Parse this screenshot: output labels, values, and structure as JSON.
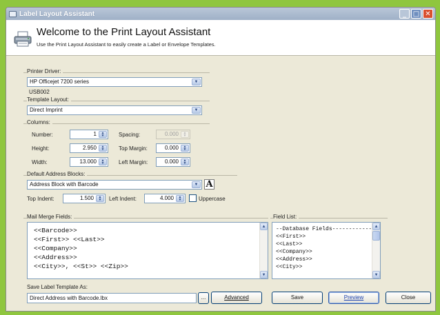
{
  "window": {
    "title": "Label Layout Assistant",
    "controls": {
      "minimize": "_",
      "maximize": "□",
      "close": "✕"
    }
  },
  "header": {
    "heading": "Welcome to the Print Layout Assistant",
    "subheading": "Use the Print Layout Assistant to easily  create a Label or Envelope Templates.",
    "icon": "printer-icon"
  },
  "printer": {
    "group_label": "Printer Driver:",
    "selected": "HP Officejet 7200 series",
    "port": "USB002"
  },
  "template_layout": {
    "group_label": "Template Layout:",
    "selected": "Direct Imprint"
  },
  "columns": {
    "group_label": "Columns:",
    "number_label": "Number:",
    "number_value": "1",
    "spacing_label": "Spacing:",
    "spacing_value": "0.000",
    "height_label": "Height:",
    "height_value": "2.950",
    "top_margin_label": "Top Margin:",
    "top_margin_value": "0.000",
    "width_label": "Width:",
    "width_value": "13.000",
    "left_margin_label": "Left Margin:",
    "left_margin_value": "0.000"
  },
  "address_blocks": {
    "group_label": "Default Address Blocks:",
    "selected": "Address Block with Barcode",
    "font_button": "A",
    "top_indent_label": "Top Indent:",
    "top_indent_value": "1.500",
    "left_indent_label": "Left Indent:",
    "left_indent_value": "4.000",
    "uppercase_label": "Uppercase",
    "uppercase_checked": false
  },
  "mail_merge": {
    "group_label": "Mail Merge Fields:",
    "lines": [
      "<<Barcode>>",
      "<<First>> <<Last>>",
      "<<Company>>",
      "<<Address>>",
      "<<City>>, <<St>> <<Zip>>"
    ]
  },
  "field_list": {
    "group_label": "Field List:",
    "items": [
      "--Database Fields-------------",
      "<<First>>",
      "<<Last>>",
      "<<Company>>",
      "<<Address>>",
      "<<City>>"
    ]
  },
  "save_template": {
    "label": "Save Label Template As:",
    "value": "Direct Address with Barcode.lbx",
    "browse": "..."
  },
  "buttons": {
    "advanced": "Advanced",
    "save": "Save",
    "preview": "Preview",
    "close": "Close"
  }
}
